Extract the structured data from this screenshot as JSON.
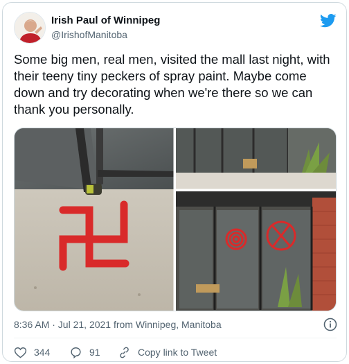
{
  "author": {
    "name": "Irish Paul of Winnipeg",
    "handle": "@IrishofManitoba"
  },
  "tweet": {
    "text": "Some big men, real men, visited the mall last night, with their teeny tiny peckers of spray paint. Maybe come down and try decorating when we're there so we can thank you personally."
  },
  "meta": {
    "timestamp": "8:36 AM · Jul 21, 2021 from Winnipeg, Manitoba"
  },
  "actions": {
    "likes": "344",
    "replies": "91",
    "copy_link": "Copy link to Tweet"
  },
  "icons": [
    "twitter-bird-icon",
    "info-icon",
    "heart-icon",
    "reply-icon",
    "link-icon"
  ],
  "colors": {
    "brand": "#1d9bf0",
    "text": "#0f1419",
    "secondary": "#536471",
    "graffiti": "#d92a2a"
  }
}
